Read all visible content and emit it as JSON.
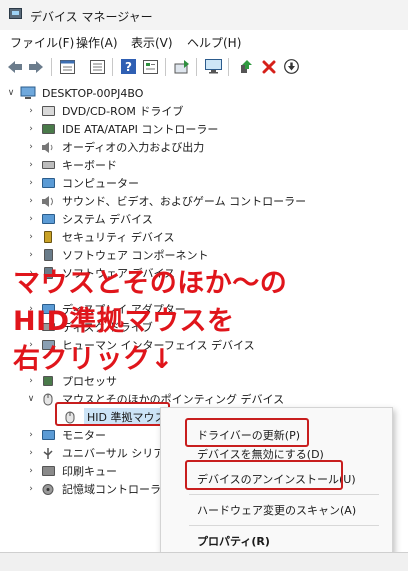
{
  "window": {
    "title": "デバイス マネージャー"
  },
  "menu": {
    "file": "ファイル(F)",
    "action": "操作(A)",
    "view": "表示(V)",
    "help": "ヘルプ(H)"
  },
  "toolbar_icons": [
    "back-arrow-icon",
    "forward-arrow-icon",
    "properties-icon",
    "update-driver-icon",
    "help-icon",
    "device-view-icon",
    "scan-hardware-icon",
    "monitor-icon",
    "enable-device-icon",
    "uninstall-x-icon",
    "disable-down-icon"
  ],
  "tree": {
    "root": "DESKTOP-00PJ4BO",
    "items": [
      "DVD/CD-ROM ドライブ",
      "IDE ATA/ATAPI コントローラー",
      "オーディオの入力および出力",
      "キーボード",
      "コンピューター",
      "サウンド、ビデオ、およびゲーム コントローラー",
      "システム デバイス",
      "セキュリティ デバイス",
      "ソフトウェア コンポーネント",
      "ソフトウェア デバイス",
      "ディスプレイ アダプター",
      "ディスク ドライブ",
      "ヒューマン インターフェイス デバイス",
      "プロセッサ",
      "マウスとそのほかのポインティング デバイス",
      "HID 準拠マウス",
      "モニター",
      "ユニバーサル シリアル バス コントローラー",
      "印刷キュー",
      "記憶域コントローラー"
    ]
  },
  "annotation": {
    "line1": "マウスとそのほか～の",
    "line2": "HID準拠マウスを",
    "line3": "右クリック↓",
    "color": "#e0151b"
  },
  "context_menu": {
    "update_driver": "ドライバーの更新(P)",
    "disable_device": "デバイスを無効にする(D)",
    "uninstall_device": "デバイスのアンインストール(U)",
    "scan_hardware": "ハードウェア変更のスキャン(A)",
    "properties": "プロパティ(R)"
  }
}
